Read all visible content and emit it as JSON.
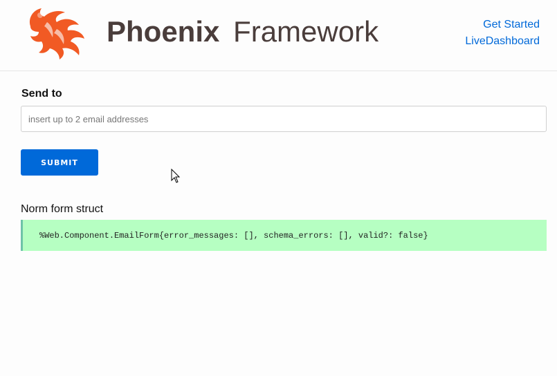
{
  "header": {
    "brand_name": "Phoenix Framework",
    "brand_bold": "Phoenix",
    "brand_light": "Framework",
    "brand_color": "#4a3d3b",
    "logo_color": "#f15a24",
    "nav": [
      {
        "label": "Get Started"
      },
      {
        "label": "LiveDashboard"
      }
    ]
  },
  "form": {
    "send_to_label": "Send to",
    "email_placeholder": "insert up to 2 email addresses",
    "email_value": "",
    "submit_label": "SUBMIT",
    "accent_color": "#0069d9"
  },
  "struct": {
    "title": "Norm form struct",
    "code": "%Web.Component.EmailForm{error_messages: [], schema_errors: [], valid?: false}",
    "background_color": "#b6ffc2"
  },
  "icons": {
    "logo": "phoenix-bird-icon",
    "cursor": "mouse-pointer-icon"
  }
}
